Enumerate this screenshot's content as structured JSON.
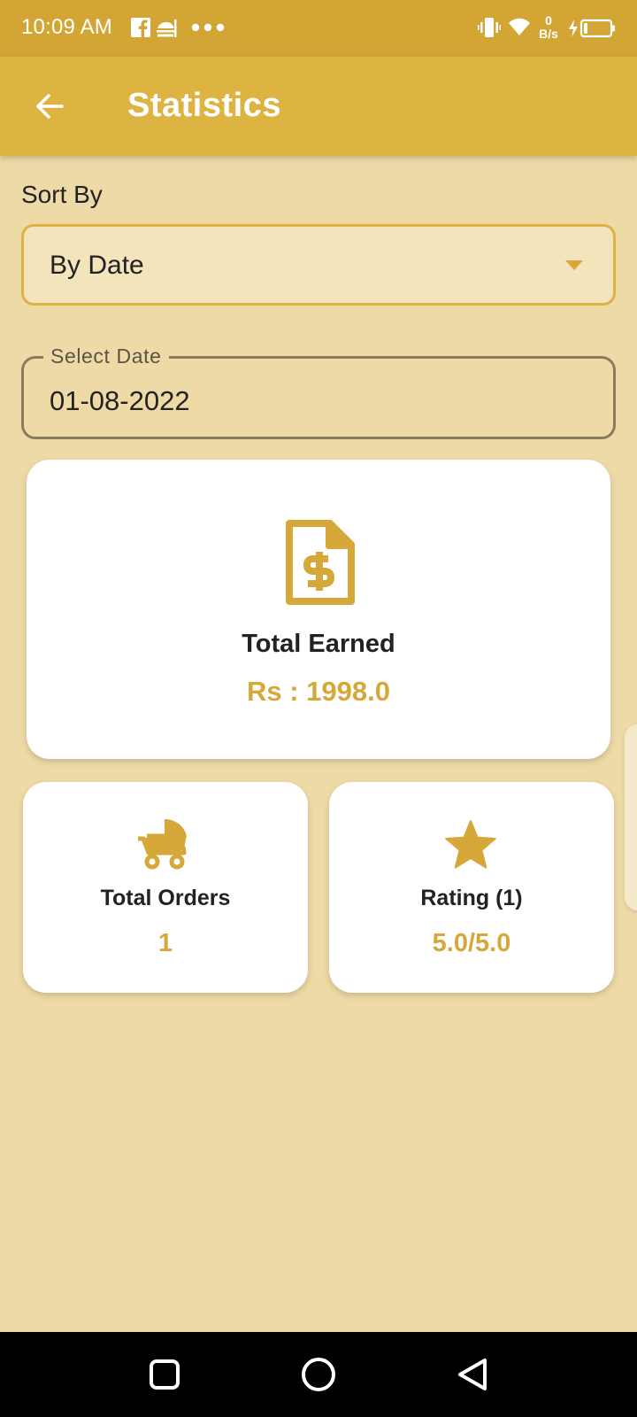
{
  "status_bar": {
    "time": "10:09 AM",
    "net_speed_value": "0",
    "net_speed_unit": "B/s",
    "icons": [
      "facebook-icon",
      "food-delivery-icon",
      "more-dots-icon",
      "vibrate-icon",
      "wifi-icon",
      "battery-charging-icon"
    ]
  },
  "app_bar": {
    "title": "Statistics",
    "back_icon": "arrow-left-icon"
  },
  "filters": {
    "sort_label": "Sort By",
    "sort_value": "By Date",
    "date_label": "Select Date",
    "date_value": "01-08-2022"
  },
  "stats": {
    "earned": {
      "icon": "invoice-dollar-icon",
      "title": "Total Earned",
      "value": "Rs : 1998.0"
    },
    "orders": {
      "icon": "cart-icon",
      "title": "Total Orders",
      "value": "1"
    },
    "rating": {
      "icon": "star-icon",
      "title": "Rating (1)",
      "value": "5.0/5.0"
    }
  },
  "nav_bar": {
    "buttons": [
      "recents-square-icon",
      "home-circle-icon",
      "back-triangle-icon"
    ]
  },
  "colors": {
    "status_bar": "#D3A534",
    "app_bar": "#DDB341",
    "background": "#EDDAA6",
    "accent": "#D6A83A",
    "card": "#FFFFFF"
  }
}
